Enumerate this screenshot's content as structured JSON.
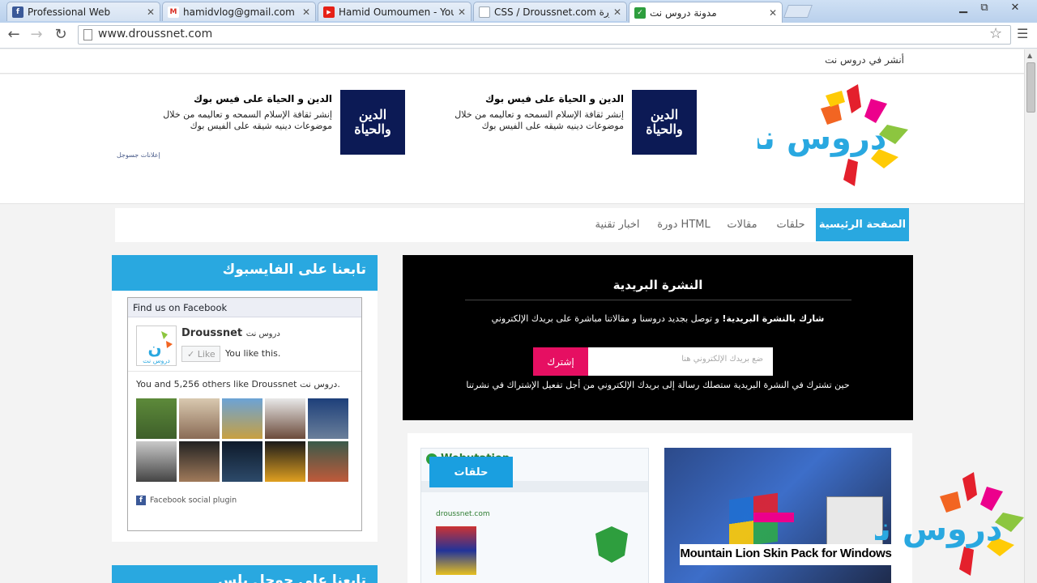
{
  "browser": {
    "tabs": [
      {
        "title": "Professional Web",
        "icon": "facebook-icon",
        "fav_color": "#3b5998",
        "fav_glyph": "f"
      },
      {
        "title": "hamidvlog@gmail.com -",
        "icon": "gmail-icon",
        "fav_color": "#d93025",
        "fav_glyph": "M"
      },
      {
        "title": "Hamid Oumoumen - You",
        "icon": "youtube-icon",
        "fav_color": "#e62117",
        "fav_glyph": "▶"
      },
      {
        "title": "CSS / Droussnet.com دورة",
        "icon": "page-icon",
        "fav_color": "#9aa6b2",
        "fav_glyph": ""
      },
      {
        "title": "مدونة دروس نت",
        "icon": "shield-icon",
        "fav_color": "#2e9e3e",
        "fav_glyph": "✓"
      }
    ],
    "url": "www.droussnet.com"
  },
  "page": {
    "top_link": "أنشر في دروس نت",
    "ads": [
      {
        "title": "الدين و الحياة على فيس بوك",
        "text": "إنشر ثقافة الإسلام السمحه و تعاليمه من خلال موضوعات دينيه شيقه على الفيس بوك",
        "image_text": "الدين والحياة"
      },
      {
        "title": "الدين و الحياة على فيس بوك",
        "text": "إنشر ثقافة الإسلام السمحه و تعاليمه من خلال موضوعات دينيه شيقه على الفيس بوك",
        "image_text": "الدين والحياة"
      }
    ],
    "ad_label": "إعلانات جسوجل",
    "nav": [
      {
        "label": "الصفحة الرئيسية",
        "active": true
      },
      {
        "label": "حلقات",
        "active": false
      },
      {
        "label": "مقالات",
        "active": false
      },
      {
        "label": "دورة HTML",
        "active": false
      },
      {
        "label": "اخبار تقنية",
        "active": false
      }
    ],
    "sidebar": {
      "facebook_title": "تابعنا على الفايسبوك",
      "second_title": "تابعنا على جوجل بلس",
      "fb": {
        "header": "Find us on Facebook",
        "page_name": "Droussnet",
        "page_name_ar": "دروس نت",
        "like": "Like",
        "you_like": "You like this.",
        "count_text": "You and 5,256 others like Droussnet دروس نت.",
        "plugin": "Facebook social plugin",
        "logo_text": "دروس نت"
      }
    },
    "newsletter": {
      "title": "النشرة البريدية",
      "desc_bold": "شارك بالنشرة البريدية!",
      "desc": " و توصل بجديد دروسنا و مقالاتنا مباشرة على بريدك الإلكتروني",
      "placeholder": "ضع بريدك الإلكتروني هنا",
      "button": "إشترك",
      "note": "حين تشترك في النشرة البريدية ستصلك رسالة إلى بريدك الإلكتروني من أجل تفعيل الإشتراك في نشرتنا"
    },
    "posts": {
      "tag": "حلقات",
      "caption": "Mountain Lion Skin Pack for Windows",
      "post1_brand": "Webutation",
      "post1_site": "droussnet.com"
    },
    "logo_text": "دروس نت",
    "colors": {
      "accent": "#29a8e0",
      "pink": "#e60f62",
      "logo_orange": "#f26522",
      "logo_red": "#e4202c",
      "logo_green": "#8cc63f",
      "logo_yellow": "#ffcb05",
      "logo_pink": "#ec008c"
    }
  }
}
